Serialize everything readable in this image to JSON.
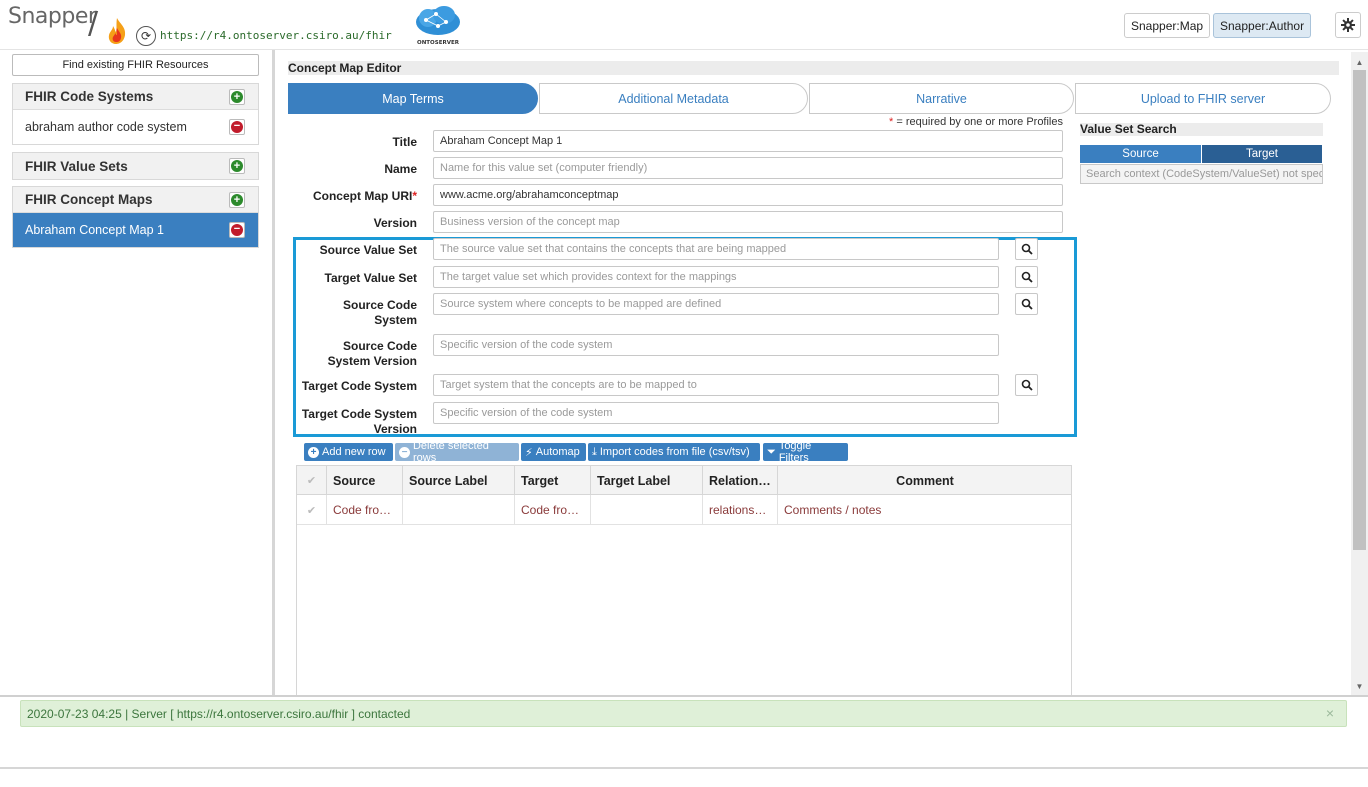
{
  "header": {
    "app_name": "Snapper",
    "server_url": "https://r4.ontoserver.csiro.au/fhir",
    "onto_label": "ONTOSERVER",
    "btn_map": "Snapper:Map",
    "btn_author": "Snapper:Author"
  },
  "sidebar": {
    "find_label": "Find existing FHIR Resources",
    "code_systems_title": "FHIR Code Systems",
    "code_system_item": "abraham author code system",
    "value_sets_title": "FHIR Value Sets",
    "concept_maps_title": "FHIR Concept Maps",
    "concept_map_item": "Abraham Concept Map 1"
  },
  "editor": {
    "title": "Concept Map Editor",
    "tabs": [
      "Map Terms",
      "Additional Metadata",
      "Narrative",
      "Upload to FHIR server"
    ],
    "required_star": "*",
    "required_note": " = required by one or more Profiles",
    "fields": {
      "title_label": "Title",
      "title_value": "Abraham Concept Map 1",
      "name_label": "Name",
      "name_ph": "Name for this value set (computer friendly)",
      "uri_label": "Concept Map URI",
      "uri_star": "*",
      "uri_value": "www.acme.org/abrahamconceptmap",
      "version_label": "Version",
      "version_ph": "Business version of the concept map",
      "src_vs_label": "Source Value Set",
      "src_vs_ph": "The source value set that contains the concepts that are being mapped",
      "tgt_vs_label": "Target Value Set",
      "tgt_vs_ph": "The target value set which provides context for the mappings",
      "src_cs_label": "Source Code System",
      "src_cs_ph": "Source system where concepts to be mapped are defined",
      "src_csv_label": "Source Code System Version",
      "src_csv_ph": "Specific version of the code system",
      "tgt_cs_label": "Target Code System",
      "tgt_cs_ph": "Target system that the concepts are to be mapped to",
      "tgt_csv_label": "Target Code System Version",
      "tgt_csv_ph": "Specific version of the code system"
    },
    "toolbar": {
      "add": "Add new row",
      "delete": "Delete selected rows",
      "automap": "Automap",
      "import": "Import codes from file (csv/tsv)",
      "filters": "Toggle Filters"
    },
    "grid": {
      "columns": [
        "Source",
        "Source Label",
        "Target",
        "Target Label",
        "Relation…",
        "Comment"
      ],
      "row": [
        "Code fro…",
        "",
        "Code fro…",
        "",
        "relations…",
        "Comments / notes"
      ]
    }
  },
  "value_set_search": {
    "title": "Value Set Search",
    "source": "Source",
    "target": "Target",
    "context": "Search context (CodeSystem/ValueSet) not specified"
  },
  "status": {
    "message": "2020-07-23 04:25 | Server [ https://r4.ontoserver.csiro.au/fhir ] contacted",
    "close": "×"
  },
  "colors": {
    "accent": "#3a7fc0",
    "highlight": "#1a9ad6",
    "success_bg": "#dff0d8"
  }
}
